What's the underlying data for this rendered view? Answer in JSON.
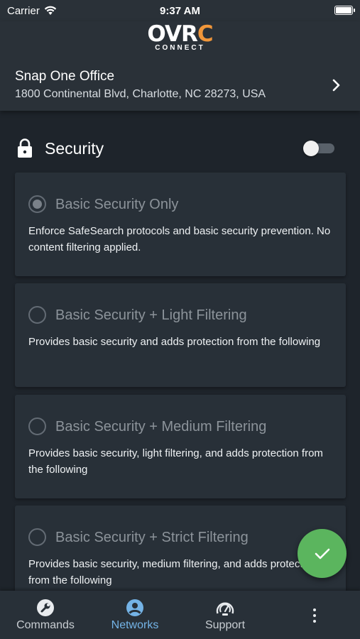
{
  "status_bar": {
    "carrier": "Carrier",
    "time": "9:37 AM"
  },
  "logo": {
    "mark_part1": "OV",
    "mark_part2": "R",
    "mark_part3": "C",
    "sub": "CONNECT"
  },
  "site": {
    "name": "Snap One Office",
    "address": "1800 Continental Blvd, Charlotte, NC 28273, USA"
  },
  "section": {
    "title": "Security",
    "toggle_on": false
  },
  "options": [
    {
      "title": "Basic Security Only",
      "description": "Enforce SafeSearch protocols and basic security prevention. No content filtering applied.",
      "selected": true
    },
    {
      "title": "Basic Security + Light Filtering",
      "description": "Provides basic security and adds protection from the following",
      "selected": false
    },
    {
      "title": "Basic Security + Medium Filtering",
      "description": "Provides basic security, light filtering, and adds protection from the following",
      "selected": false
    },
    {
      "title": "Basic Security + Strict Filtering",
      "description": "Provides basic security, medium filtering, and adds protection from the following",
      "selected": false
    }
  ],
  "bottom_nav": {
    "items": [
      {
        "label": "Commands",
        "icon": "wrench-icon"
      },
      {
        "label": "Networks",
        "icon": "account-circle-icon",
        "active": true
      },
      {
        "label": "Support",
        "icon": "support-gauge-icon"
      }
    ],
    "more_icon": "more-vertical-icon"
  },
  "colors": {
    "accent": "#74b3e6",
    "fab": "#5bb55e",
    "logo_accent": "#f0963a",
    "background": "#1e242b",
    "card": "#283038"
  }
}
